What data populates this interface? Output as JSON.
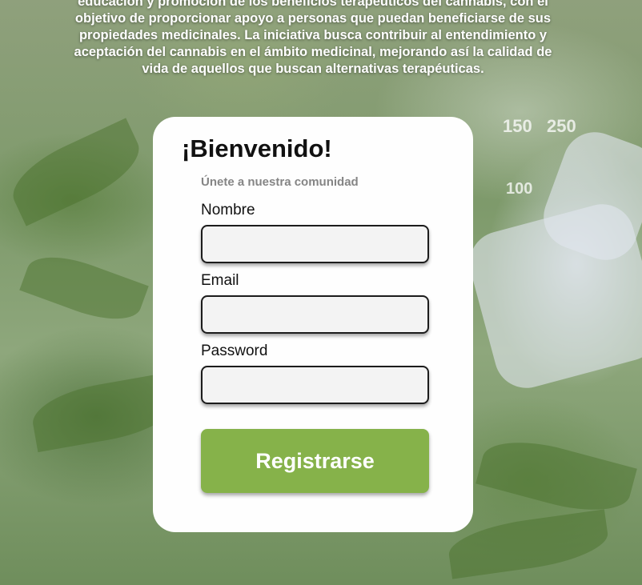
{
  "intro": {
    "text": "educación y promoción de los beneficios terapéuticos del cannabis, con el objetivo de proporcionar apoyo a personas que puedan beneficiarse de sus propiedades medicinales. La iniciativa busca contribuir al entendimiento y aceptación del cannabis en el ámbito medicinal, mejorando así la calidad de vida de aquellos que buscan alternativas terapéuticas."
  },
  "card": {
    "title": "¡Bienvenido!",
    "subtitle": "Únete a nuestra comunidad",
    "fields": {
      "name_label": "Nombre",
      "name_value": "",
      "email_label": "Email",
      "email_value": "",
      "password_label": "Password",
      "password_value": ""
    },
    "submit_label": "Registrarse"
  },
  "colors": {
    "button": "#86b24a",
    "input_bg": "#f3f3f3",
    "subtitle": "#858585"
  }
}
